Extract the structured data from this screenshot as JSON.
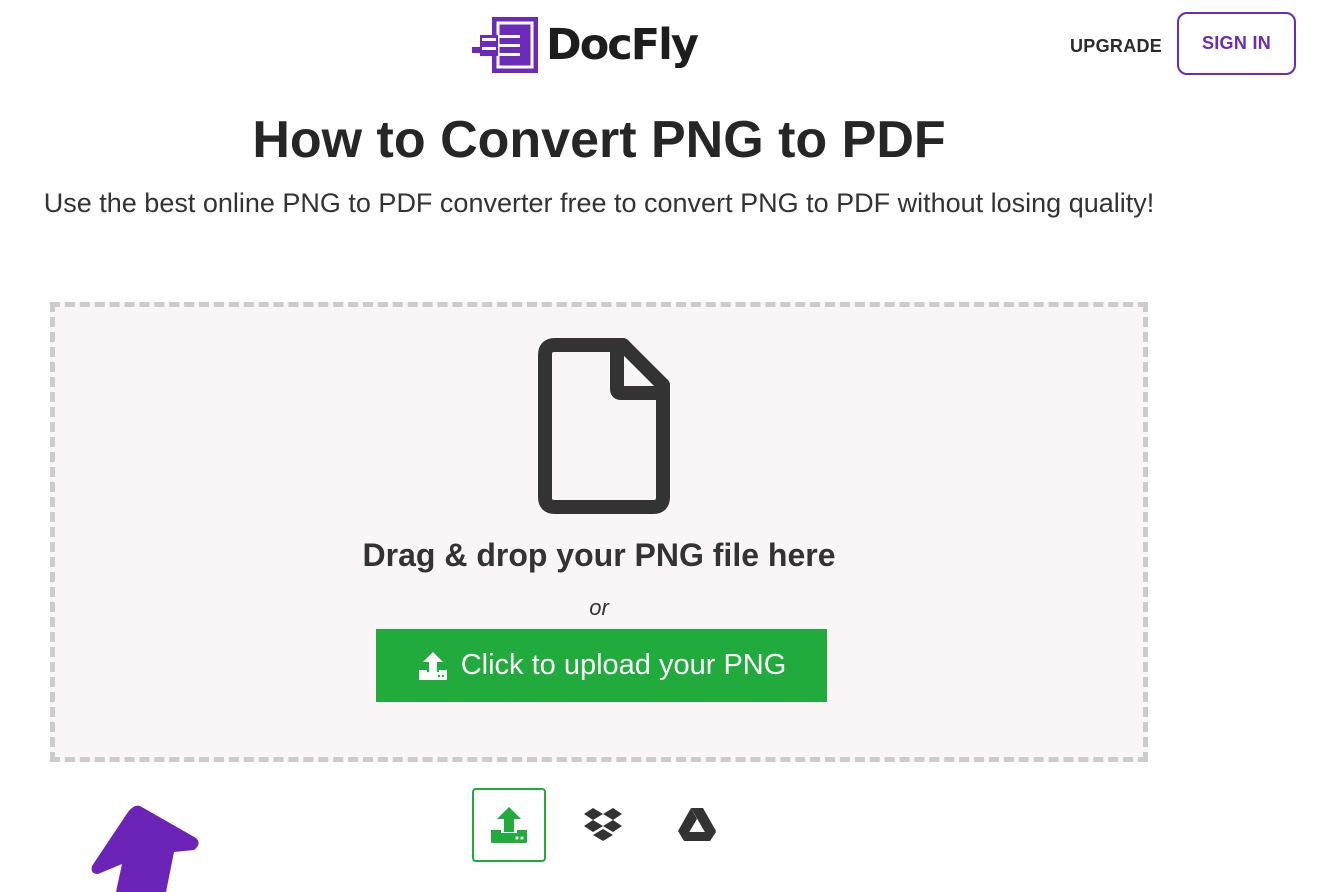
{
  "header": {
    "logo_text": "DocFly",
    "upgrade_label": "UPGRADE",
    "signin_label": "SIGN IN"
  },
  "main": {
    "title": "How to Convert PNG to PDF",
    "subtitle": "Use the best online PNG to PDF converter free to convert PNG to PDF without losing quality!",
    "dropzone": {
      "drop_text": "Drag & drop your PNG file here",
      "or_text": "or",
      "upload_label": "Click to upload your PNG"
    },
    "sources": [
      {
        "icon": "upload-icon",
        "active": true
      },
      {
        "icon": "dropbox-icon",
        "active": false
      },
      {
        "icon": "google-drive-icon",
        "active": false
      }
    ]
  },
  "colors": {
    "brand": "#6b2bb8",
    "upload_green": "#20ab3c",
    "dropzone_bg": "#faf6f8",
    "dropzone_border": "#cccccc"
  }
}
